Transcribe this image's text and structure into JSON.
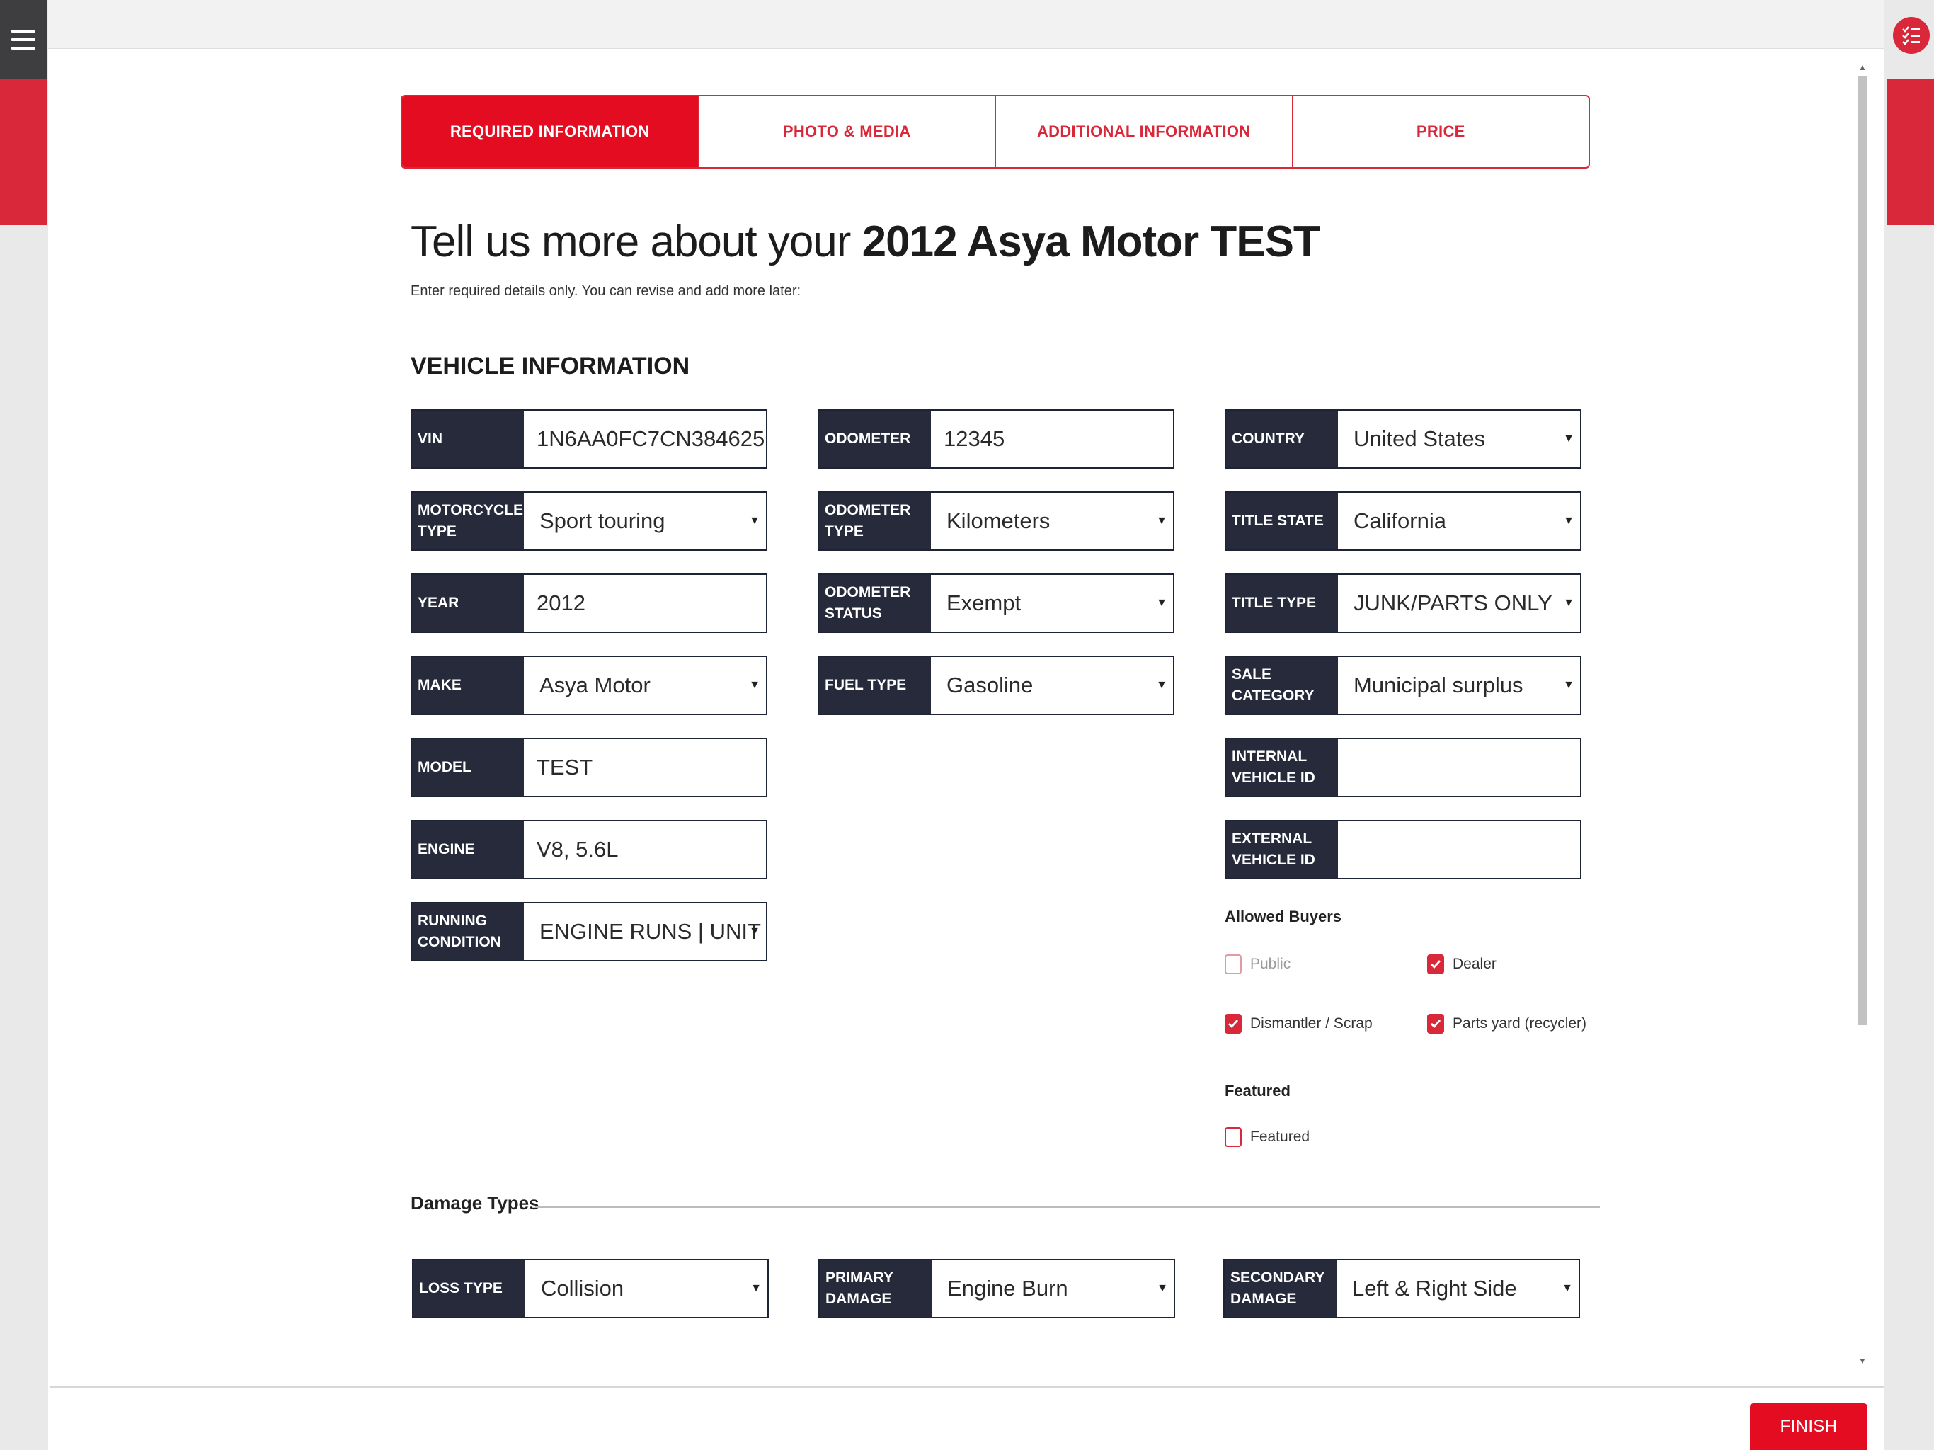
{
  "tabs": [
    {
      "label": "REQUIRED INFORMATION",
      "active": true
    },
    {
      "label": "PHOTO & MEDIA",
      "active": false
    },
    {
      "label": "ADDITIONAL INFORMATION",
      "active": false
    },
    {
      "label": "PRICE",
      "active": false
    }
  ],
  "heading": {
    "prefix": "Tell us more about your ",
    "vehicle": "2012 Asya Motor TEST"
  },
  "subtitle": "Enter required details only. You can revise and add more later:",
  "section_title": "VEHICLE INFORMATION",
  "fields": {
    "vin": {
      "label": "VIN",
      "value": "1N6AA0FC7CN384625"
    },
    "motorcycle_type": {
      "label": "MOTORCYCLE TYPE",
      "value": "Sport touring"
    },
    "year": {
      "label": "YEAR",
      "value": "2012"
    },
    "make": {
      "label": "MAKE",
      "value": "Asya Motor"
    },
    "model": {
      "label": "MODEL",
      "value": "TEST"
    },
    "engine": {
      "label": "ENGINE",
      "value": "V8, 5.6L"
    },
    "running_condition": {
      "label": "RUNNING CONDITION",
      "value": "ENGINE RUNS | UNIT MO'"
    },
    "odometer": {
      "label": "ODOMETER",
      "value": "12345"
    },
    "odometer_type": {
      "label": "ODOMETER TYPE",
      "value": "Kilometers"
    },
    "odometer_status": {
      "label": "ODOMETER STATUS",
      "value": "Exempt"
    },
    "fuel_type": {
      "label": "FUEL TYPE",
      "value": "Gasoline"
    },
    "country": {
      "label": "COUNTRY",
      "value": "United States"
    },
    "title_state": {
      "label": "TITLE STATE",
      "value": "California"
    },
    "title_type": {
      "label": "TITLE TYPE",
      "value": "JUNK/PARTS ONLY"
    },
    "sale_category": {
      "label": "SALE CATEGORY",
      "value": "Municipal surplus"
    },
    "internal_vehicle_id": {
      "label": "INTERNAL VEHICLE ID",
      "value": ""
    },
    "external_vehicle_id": {
      "label": "EXTERNAL VEHICLE ID",
      "value": ""
    }
  },
  "allowed_buyers": {
    "title": "Allowed Buyers",
    "options": {
      "public": {
        "label": "Public",
        "checked": false
      },
      "dealer": {
        "label": "Dealer",
        "checked": true
      },
      "dismantler": {
        "label": "Dismantler / Scrap",
        "checked": true
      },
      "parts_yard": {
        "label": "Parts yard (recycler)",
        "checked": true
      }
    }
  },
  "featured": {
    "title": "Featured",
    "label": "Featured",
    "checked": false
  },
  "damage": {
    "title": "Damage Types",
    "loss_type": {
      "label": "LOSS TYPE",
      "value": "Collision"
    },
    "primary_damage": {
      "label": "PRIMARY DAMAGE",
      "value": "Engine Burn"
    },
    "secondary_damage": {
      "label": "SECONDARY DAMAGE",
      "value": "Left & Right Side"
    }
  },
  "finish_label": "FINISH",
  "colors": {
    "accent": "#e30c21",
    "label_bg": "#262a3b"
  }
}
